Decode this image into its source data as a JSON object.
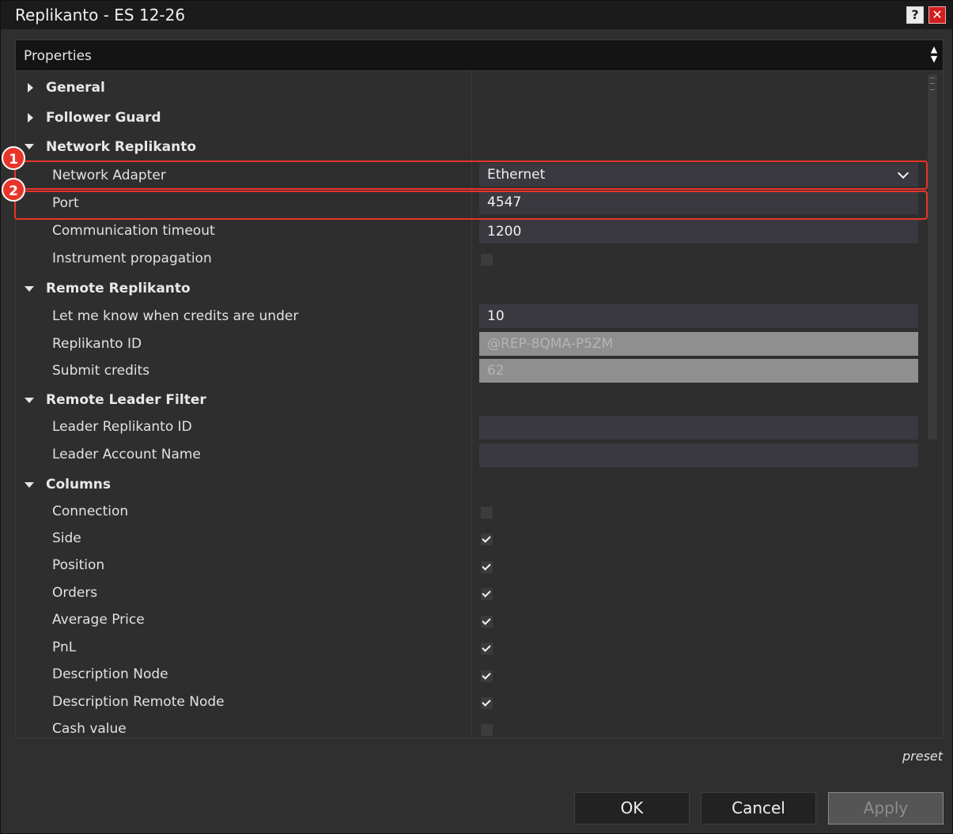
{
  "window": {
    "title": "Replikanto - ES 12-26",
    "help_label": "?",
    "close_label": "✕"
  },
  "panel": {
    "title": "Properties"
  },
  "categories": {
    "general": "General",
    "follower_guard": "Follower Guard",
    "network_replikanto": "Network Replikanto",
    "remote_replikanto": "Remote Replikanto",
    "remote_leader_filter": "Remote Leader Filter",
    "columns": "Columns"
  },
  "network": {
    "adapter": {
      "label": "Network Adapter",
      "value": "Ethernet"
    },
    "port": {
      "label": "Port",
      "value": "4547"
    },
    "timeout": {
      "label": "Communication timeout",
      "value": "1200"
    },
    "propagation": {
      "label": "Instrument propagation",
      "checked": false
    }
  },
  "remote": {
    "credits_alert": {
      "label": "Let me know when credits are under",
      "value": "10"
    },
    "replikanto_id": {
      "label": "Replikanto ID",
      "value": "@REP-8QMA-P5ZM"
    },
    "submit_credits": {
      "label": "Submit credits",
      "value": "62"
    }
  },
  "leader_filter": {
    "leader_id": {
      "label": "Leader Replikanto ID",
      "value": ""
    },
    "leader_account": {
      "label": "Leader Account Name",
      "value": ""
    }
  },
  "columns": [
    {
      "label": "Connection",
      "checked": false
    },
    {
      "label": "Side",
      "checked": true
    },
    {
      "label": "Position",
      "checked": true
    },
    {
      "label": "Orders",
      "checked": true
    },
    {
      "label": "Average Price",
      "checked": true
    },
    {
      "label": "PnL",
      "checked": true
    },
    {
      "label": "Description Node",
      "checked": true
    },
    {
      "label": "Description Remote Node",
      "checked": true
    },
    {
      "label": "Cash value",
      "checked": false
    }
  ],
  "annotations": {
    "badge1": "1",
    "badge2": "2"
  },
  "footer": {
    "preset": "preset",
    "ok": "OK",
    "cancel": "Cancel",
    "apply": "Apply"
  }
}
